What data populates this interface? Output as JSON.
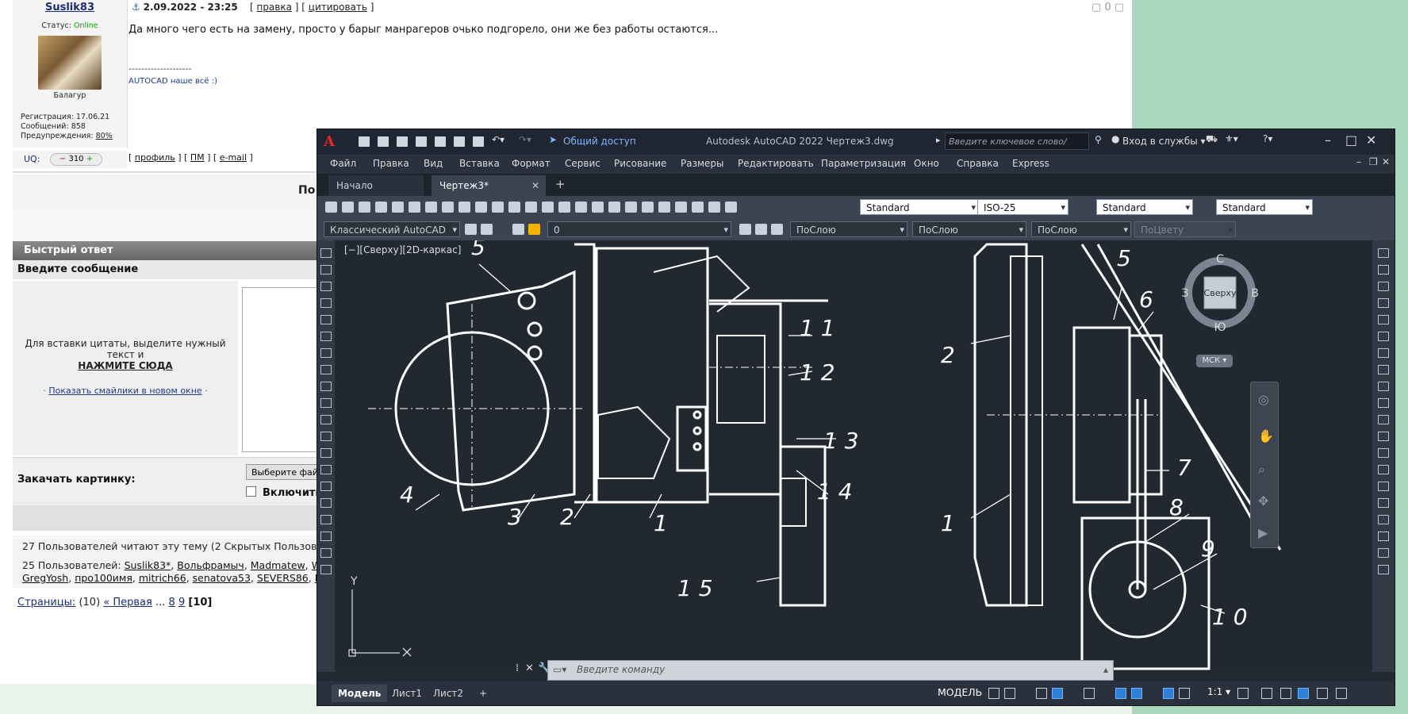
{
  "forum": {
    "post": {
      "username": "Suslik83",
      "status_label": "Статус:",
      "status_value": "Online",
      "rank": "Балагур",
      "registration": "Регистрация: 17.06.21",
      "messages": "Сообщений: 858",
      "warnings_label": "Предупреждения:",
      "warnings_value": "80%",
      "date": "2.09.2022 - 23:25",
      "edit_link": "правка",
      "quote_link": "цитировать",
      "vote_count": "0",
      "body": "Да много чего есть на замену, просто у барыг манрагеров очько подгорело, они же без работы остаются...",
      "sig_separator": "--------------------",
      "signature": "AUTOCAD наше всё :)",
      "uq_label": "UQ:",
      "uq_value": "310",
      "profile_link": "профиль",
      "pm_link": "ПМ",
      "email_link": "e-mail"
    },
    "pag_top": "По",
    "quick_reply": {
      "header": "Быстрый ответ",
      "enter_message": "Введите сообщение",
      "quote_hint_1": "Для вставки цитаты, выделите нужный",
      "quote_hint_2": "текст и",
      "click_here": "НАЖМИТЕ СЮДА",
      "smiles_link": "Показать смайлики в новом окне",
      "upload_label": "Закачать картинку:",
      "choose_file": "Выберите фай",
      "include_label": "Включить"
    },
    "readers": {
      "line1": "27 Пользователей читают эту тему (2 Скрытых Пользовате",
      "line2_prefix": "25 Пользователей:",
      "users_row1": [
        "Suslik83*",
        "Вольфрамыч",
        "Madmatew",
        "Wa"
      ],
      "users_row2": [
        "GregYosh",
        "про100имя",
        "mitrich66",
        "senatova53",
        "SEVERS86",
        "Mi"
      ]
    },
    "pages": {
      "label": "Страницы:",
      "count": "(10)",
      "first": "« Первая",
      "dots": "...",
      "p8": "8",
      "p9": "9",
      "current": "[10]"
    }
  },
  "acad": {
    "title": "Autodesk AutoCAD 2022    Чертеж3.dwg",
    "share": "Общий доступ",
    "search_placeholder": "Введите ключевое слово/фразу",
    "login": "Вход в службы",
    "menu": [
      "Файл",
      "Правка",
      "Вид",
      "Вставка",
      "Формат",
      "Сервис",
      "Рисование",
      "Размеры",
      "Редактировать",
      "Параметризация",
      "Окно",
      "Справка",
      "Express"
    ],
    "tabs": [
      "Начало",
      "Чертеж3*"
    ],
    "combos_row1": [
      "Standard",
      "ISO-25",
      "Standard",
      "Standard"
    ],
    "workspace": "Классический AutoCAD",
    "layer": "0",
    "bylayer": [
      "ПоСлою",
      "ПоСлою",
      "ПоСлою"
    ],
    "bycolor": "ПоЦвету",
    "viewport_label": "[−][Сверху][2D-каркас]",
    "viewcube": {
      "n": "С",
      "s": "Ю",
      "e": "В",
      "w": "З",
      "face": "Сверху",
      "wcs": "МСК"
    },
    "ucs": {
      "y": "Y"
    },
    "cmd_placeholder": "Введите команду",
    "layout_tabs": [
      "Модель",
      "Лист1",
      "Лист2"
    ],
    "status_model": "МОДЕЛЬ",
    "scale": "1:1",
    "drawing_labels": [
      "5",
      "11",
      "12",
      "13",
      "14",
      "4",
      "3",
      "2",
      "1",
      "15",
      "5",
      "6",
      "2",
      "7",
      "1",
      "8",
      "9",
      "10"
    ]
  }
}
